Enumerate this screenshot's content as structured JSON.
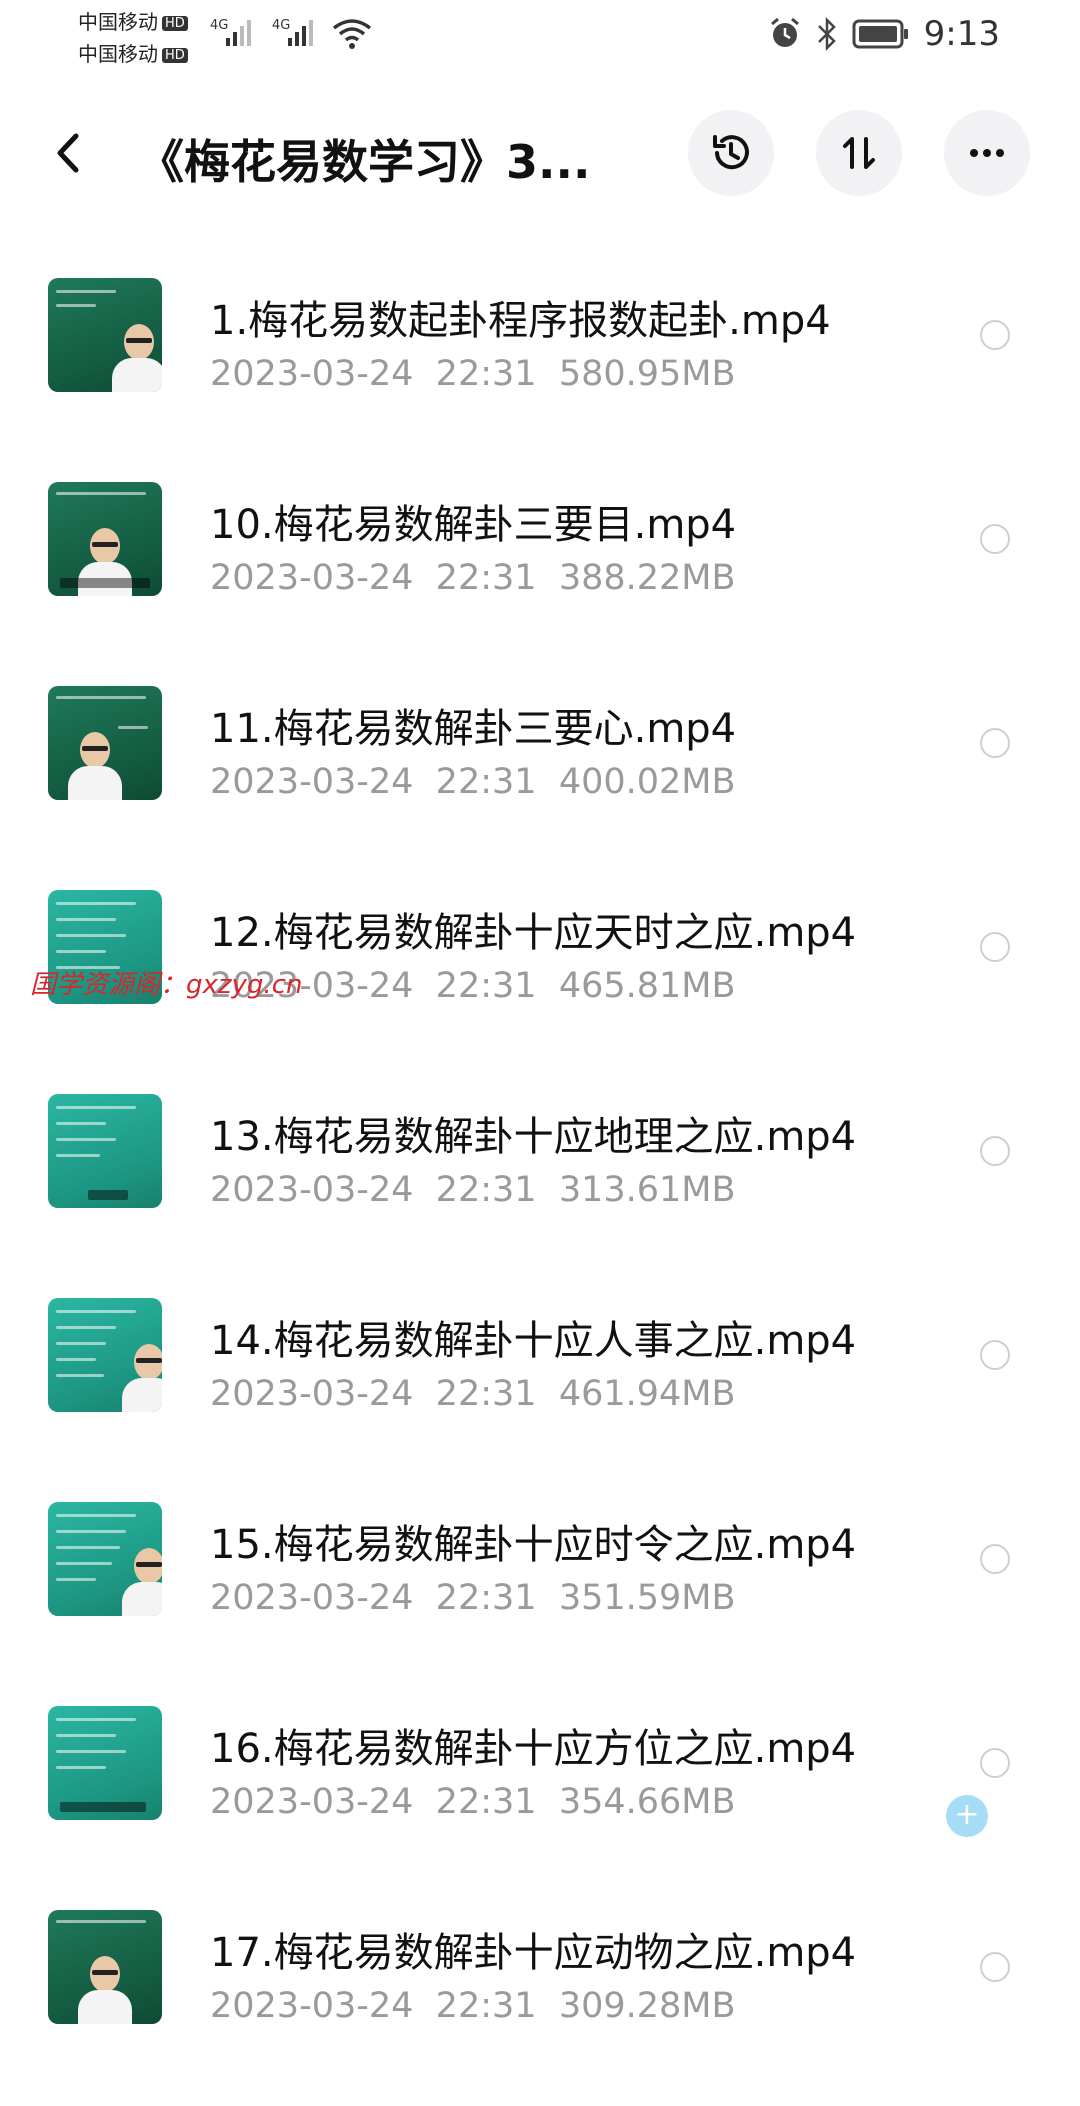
{
  "status_bar": {
    "carrier_1": "中国移动",
    "carrier_2": "中国移动",
    "hd_badge": "HD",
    "network_1": "4G",
    "network_2": "4G",
    "time": "9:13"
  },
  "header": {
    "title": "《梅花易数学习》3..."
  },
  "files": [
    {
      "name": "1.梅花易数起卦程序报数起卦.mp4",
      "date": "2023-03-24",
      "time": "22:31",
      "size": "580.95MB"
    },
    {
      "name": "10.梅花易数解卦三要目.mp4",
      "date": "2023-03-24",
      "time": "22:31",
      "size": "388.22MB"
    },
    {
      "name": "11.梅花易数解卦三要心.mp4",
      "date": "2023-03-24",
      "time": "22:31",
      "size": "400.02MB"
    },
    {
      "name": "12.梅花易数解卦十应天时之应.mp4",
      "date": "2023-03-24",
      "time": "22:31",
      "size": "465.81MB"
    },
    {
      "name": "13.梅花易数解卦十应地理之应.mp4",
      "date": "2023-03-24",
      "time": "22:31",
      "size": "313.61MB"
    },
    {
      "name": "14.梅花易数解卦十应人事之应.mp4",
      "date": "2023-03-24",
      "time": "22:31",
      "size": "461.94MB"
    },
    {
      "name": "15.梅花易数解卦十应时令之应.mp4",
      "date": "2023-03-24",
      "time": "22:31",
      "size": "351.59MB"
    },
    {
      "name": "16.梅花易数解卦十应方位之应.mp4",
      "date": "2023-03-24",
      "time": "22:31",
      "size": "354.66MB"
    },
    {
      "name": "17.梅花易数解卦十应动物之应.mp4",
      "date": "2023-03-24",
      "time": "22:31",
      "size": "309.28MB"
    }
  ],
  "watermark": "国学资源阁：gxzyg.cn",
  "fab": {
    "label": "+"
  },
  "colors": {
    "accent_fab": "#a6ddf6",
    "watermark": "#d8262c",
    "meta_text": "#9a9a9a"
  }
}
